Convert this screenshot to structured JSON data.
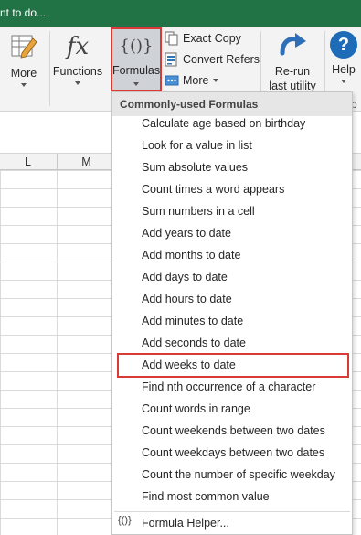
{
  "titlebar": {
    "search_text": "nt to do..."
  },
  "ribbon": {
    "more": "More",
    "functions": "Functions",
    "formulas": "Formulas",
    "exact_copy": "Exact Copy",
    "convert_refers": "Convert Refers",
    "more_small": "More",
    "rerun_line1": "Re-run",
    "rerun_line2": "last utility",
    "help": "Help",
    "formulas_glyph": "{()}",
    "fx_glyph": "fx",
    "help_glyph": "?",
    "group_tail": "p"
  },
  "columns": [
    "L",
    "M"
  ],
  "menu": {
    "header": "Commonly-used Formulas",
    "items": [
      "Calculate age based on birthday",
      "Look for a value in list",
      "Sum absolute values",
      "Count times a word appears",
      "Sum numbers in a cell",
      "Add years to date",
      "Add months to date",
      "Add days to date",
      "Add hours to date",
      "Add minutes to date",
      "Add seconds to date",
      "Add weeks to date",
      "Find nth occurrence of a character",
      "Count words in range",
      "Count weekends between two dates",
      "Count weekdays between two dates",
      "Count the number of specific weekday",
      "Find most common value"
    ],
    "highlighted_index": 11,
    "helper_icon": "{()}",
    "helper_label": "Formula Helper..."
  },
  "colors": {
    "titlebar": "#217346",
    "highlight_border": "#d93a35",
    "accent_blue": "#1e6bb8"
  }
}
